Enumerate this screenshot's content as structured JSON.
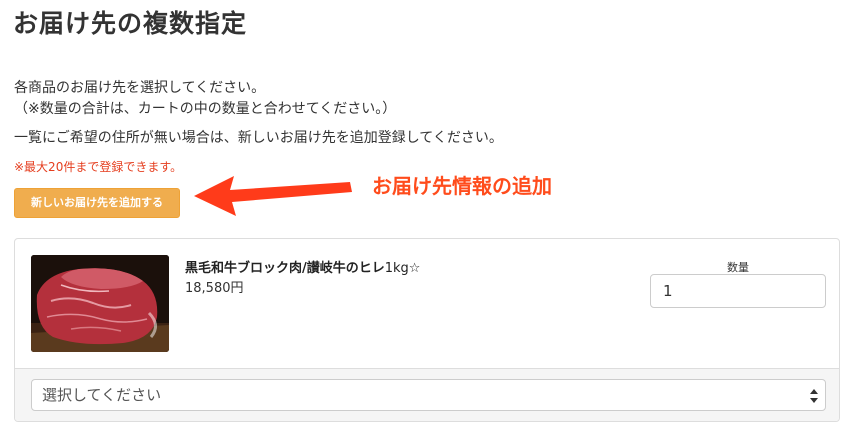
{
  "page": {
    "title": "お届け先の複数指定"
  },
  "intro": {
    "line1": "各商品のお届け先を選択してください。",
    "line2": "（※数量の合計は、カートの中の数量と合わせてください。）",
    "line3": "一覧にご希望の住所が無い場合は、新しいお届け先を追加登録してください。",
    "notice": "※最大20件まで登録できます。"
  },
  "actions": {
    "add_address_label": "新しいお届け先を追加する"
  },
  "annotation": {
    "label": "お届け先情報の追加",
    "color": "#ff4c1c"
  },
  "item": {
    "name": "黒毛和牛ブロック肉/讃岐牛のヒレ",
    "unit": "1kg☆",
    "price": "18,580円",
    "quantity_label": "数量",
    "quantity_value": "1",
    "image_icon": "beef-block-photo"
  },
  "address": {
    "selected": "選択してください"
  },
  "colors": {
    "button": "#f0ad4e",
    "notice": "#e53e1f",
    "footer_bg": "#f5f5f5"
  }
}
